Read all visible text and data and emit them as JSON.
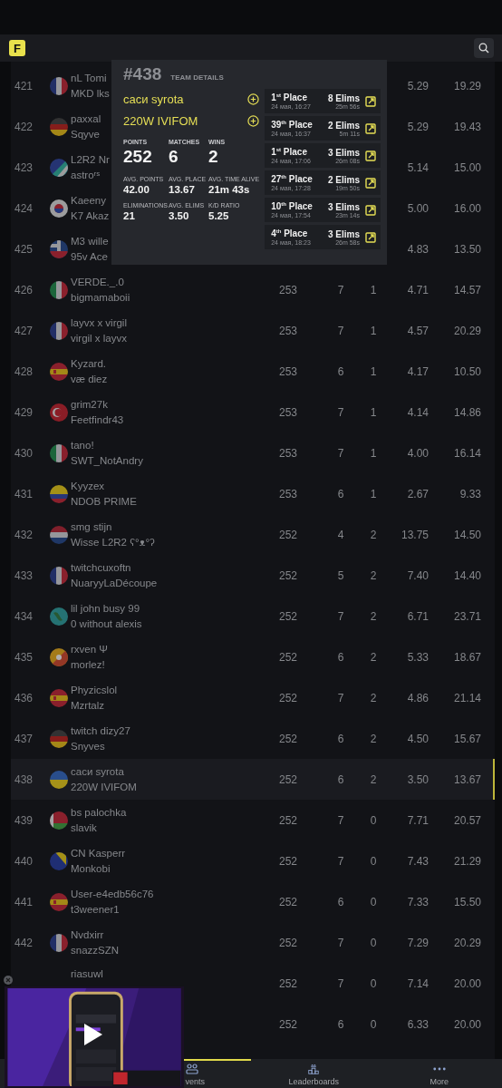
{
  "header": {
    "logo": "F"
  },
  "rows": [
    {
      "rank": "421",
      "names": [
        "nL Tomi",
        "MKD lks"
      ],
      "avg_elims": "5.29",
      "avg_place": "19.29",
      "selected": false
    },
    {
      "rank": "422",
      "names": [
        "paxxal",
        "Sqyve"
      ],
      "avg_elims": "5.29",
      "avg_place": "19.43",
      "selected": false
    },
    {
      "rank": "423",
      "names": [
        "L2R2 Nr",
        "astroʳˢ"
      ],
      "avg_elims": "5.14",
      "avg_place": "15.00",
      "selected": false
    },
    {
      "rank": "424",
      "names": [
        "Kaeeny",
        "K7 Akaz"
      ],
      "avg_elims": "5.00",
      "avg_place": "16.00",
      "selected": false
    },
    {
      "rank": "425",
      "names": [
        "M3 wille",
        "95v Ace"
      ],
      "avg_elims": "4.83",
      "avg_place": "13.50",
      "selected": false
    },
    {
      "rank": "426",
      "names": [
        "VERDE._.0",
        "bigmamaboii"
      ],
      "points": "253",
      "matches": "7",
      "wins": "1",
      "avg_elims": "4.71",
      "avg_place": "14.57",
      "selected": false
    },
    {
      "rank": "427",
      "names": [
        "layvx x virgil",
        "virgil x layvx"
      ],
      "points": "253",
      "matches": "7",
      "wins": "1",
      "avg_elims": "4.57",
      "avg_place": "20.29",
      "selected": false
    },
    {
      "rank": "428",
      "names": [
        "Kyzard.",
        "væ diez"
      ],
      "points": "253",
      "matches": "6",
      "wins": "1",
      "avg_elims": "4.17",
      "avg_place": "10.50",
      "selected": false
    },
    {
      "rank": "429",
      "names": [
        "grim27k",
        "Feetfindr43"
      ],
      "points": "253",
      "matches": "7",
      "wins": "1",
      "avg_elims": "4.14",
      "avg_place": "14.86",
      "selected": false
    },
    {
      "rank": "430",
      "names": [
        "tano!",
        "SWT_NotAndry"
      ],
      "points": "253",
      "matches": "7",
      "wins": "1",
      "avg_elims": "4.00",
      "avg_place": "16.14",
      "selected": false
    },
    {
      "rank": "431",
      "names": [
        "Kyyzex",
        "NDOB PRIME"
      ],
      "points": "253",
      "matches": "6",
      "wins": "1",
      "avg_elims": "2.67",
      "avg_place": "9.33",
      "selected": false
    },
    {
      "rank": "432",
      "names": [
        "smg stijn",
        "Wisse L2R2 ʕ°ᴥ°ʔ"
      ],
      "points": "252",
      "matches": "4",
      "wins": "2",
      "avg_elims": "13.75",
      "avg_place": "14.50",
      "selected": false
    },
    {
      "rank": "433",
      "names": [
        "twitchcuxoftn",
        "NuaryyLaDécoupe"
      ],
      "points": "252",
      "matches": "5",
      "wins": "2",
      "avg_elims": "7.40",
      "avg_place": "14.40",
      "selected": false
    },
    {
      "rank": "434",
      "names": [
        "lil john busy 99",
        "0 without alexis"
      ],
      "points": "252",
      "matches": "7",
      "wins": "2",
      "avg_elims": "6.71",
      "avg_place": "23.71",
      "selected": false
    },
    {
      "rank": "435",
      "names": [
        "rxven Ψ",
        "morlez!"
      ],
      "points": "252",
      "matches": "6",
      "wins": "2",
      "avg_elims": "5.33",
      "avg_place": "18.67",
      "selected": false
    },
    {
      "rank": "436",
      "names": [
        "Phyzicslol",
        "Mzrtalz"
      ],
      "points": "252",
      "matches": "7",
      "wins": "2",
      "avg_elims": "4.86",
      "avg_place": "21.14",
      "selected": false
    },
    {
      "rank": "437",
      "names": [
        "twitch dizy27",
        "Snyves"
      ],
      "points": "252",
      "matches": "6",
      "wins": "2",
      "avg_elims": "4.50",
      "avg_place": "15.67",
      "selected": false
    },
    {
      "rank": "438",
      "names": [
        "саси syrota",
        "220W IVIFOM"
      ],
      "points": "252",
      "matches": "6",
      "wins": "2",
      "avg_elims": "3.50",
      "avg_place": "13.67",
      "selected": true
    },
    {
      "rank": "439",
      "names": [
        "bs palochka",
        "slavik"
      ],
      "points": "252",
      "matches": "7",
      "wins": "0",
      "avg_elims": "7.71",
      "avg_place": "20.57",
      "selected": false
    },
    {
      "rank": "440",
      "names": [
        "CN Kasperr",
        "Monkobi"
      ],
      "points": "252",
      "matches": "7",
      "wins": "0",
      "avg_elims": "7.43",
      "avg_place": "21.29",
      "selected": false
    },
    {
      "rank": "441",
      "names": [
        "User-e4edb56c76",
        "t3weener1"
      ],
      "points": "252",
      "matches": "6",
      "wins": "0",
      "avg_elims": "7.33",
      "avg_place": "15.50",
      "selected": false
    },
    {
      "rank": "442",
      "names": [
        "Nvdxirr",
        "snazzSZN"
      ],
      "points": "252",
      "matches": "7",
      "wins": "0",
      "avg_elims": "7.29",
      "avg_place": "20.29",
      "selected": false
    },
    {
      "names": [
        "riasuwl"
      ],
      "points": "252",
      "matches": "7",
      "wins": "0",
      "avg_elims": "7.14",
      "avg_place": "20.00",
      "selected": false
    },
    {
      "points": "252",
      "matches": "6",
      "wins": "0",
      "avg_elims": "6.33",
      "avg_place": "20.00",
      "selected": false
    }
  ],
  "team_details": {
    "number": "#438",
    "title": "TEAM DETAILS",
    "members": [
      "саси syrota",
      "220W IVIFOM"
    ],
    "main_stats": [
      {
        "label": "POINTS",
        "value": "252"
      },
      {
        "label": "MATCHES",
        "value": "6"
      },
      {
        "label": "WINS",
        "value": "2"
      }
    ],
    "sub_stats": [
      {
        "label": "AVG. POINTS",
        "value": "42.00"
      },
      {
        "label": "AVG. PLACE",
        "value": "13.67"
      },
      {
        "label": "AVG. TIME ALIVE",
        "value": "21m 43s"
      },
      {
        "label": "ELIMINATIONS",
        "value": "21"
      },
      {
        "label": "AVG. ELIMS",
        "value": "3.50"
      },
      {
        "label": "K/D RATIO",
        "value": "5.25"
      }
    ],
    "matches": [
      {
        "place": "1$^{st}$ Place",
        "date": "24 мая, 16:27",
        "elims": "8 Elims",
        "time": "25m 56s"
      },
      {
        "place": "39$^{th}$ Place",
        "date": "24 мая, 16:37",
        "elims": "2 Elims",
        "time": "5m 11s"
      },
      {
        "place": "1$^{st}$ Place",
        "date": "24 мая, 17:06",
        "elims": "3 Elims",
        "time": "26m 08s"
      },
      {
        "place": "27$^{th}$ Place",
        "date": "24 мая, 17:28",
        "elims": "2 Elims",
        "time": "19m 50s"
      },
      {
        "place": "10$^{th}$ Place",
        "date": "24 мая, 17:54",
        "elims": "3 Elims",
        "time": "23m 14s"
      },
      {
        "place": "4$^{th}$ Place",
        "date": "24 мая, 18:23",
        "elims": "3 Elims",
        "time": "26m 58s"
      }
    ]
  },
  "nav": [
    {
      "label": "vents",
      "selected": true,
      "cut_left": true
    },
    {
      "label": "Leaderboards",
      "selected": false,
      "cut_left": false
    },
    {
      "label": "More",
      "selected": false,
      "cut_left": false
    }
  ]
}
